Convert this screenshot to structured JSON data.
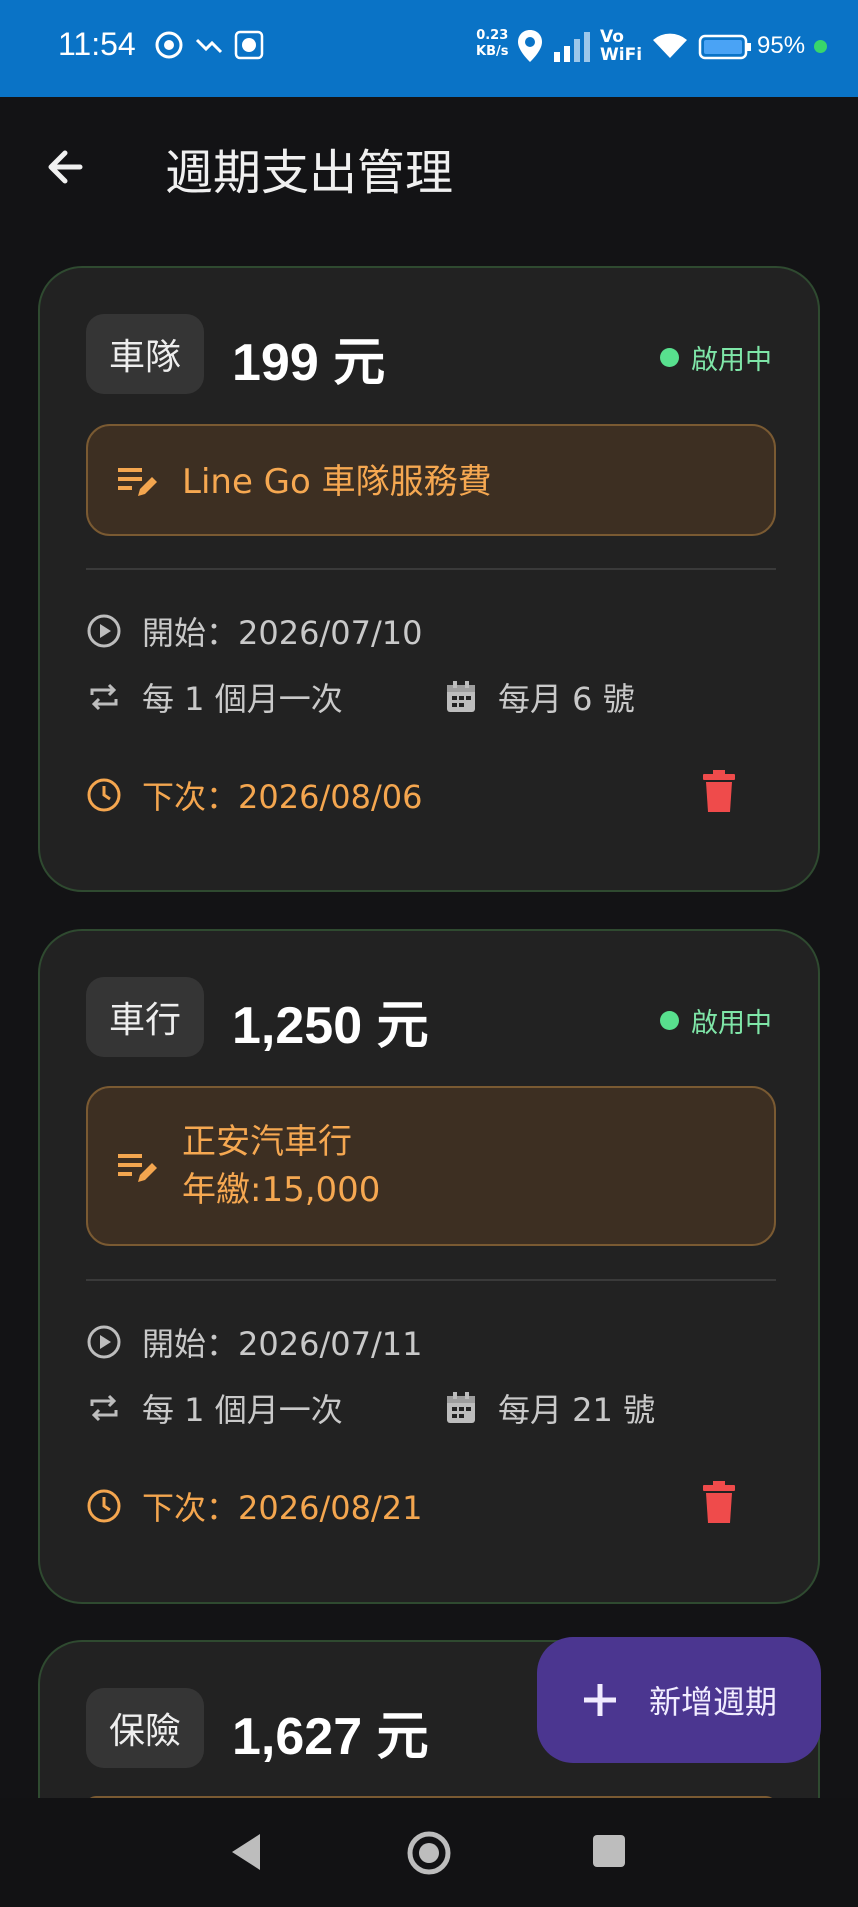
{
  "status_bar": {
    "time": "11:54",
    "net_speed_value": "0.23",
    "net_speed_unit": "KB/s",
    "vowifi_top": "Vo",
    "vowifi_bottom": "WiFi",
    "battery": "95%"
  },
  "header": {
    "title": "週期支出管理"
  },
  "cards": [
    {
      "category": "車隊",
      "amount": "199 元",
      "status": "啟用中",
      "note_line1": "Line Go 車隊服務費",
      "note_line2": "",
      "start": "開始：2026/07/10",
      "frequency": "每 1 個月一次",
      "day": "每月 6 號",
      "next": "下次：2026/08/06"
    },
    {
      "category": "車行",
      "amount": "1,250 元",
      "status": "啟用中",
      "note_line1": "正安汽車行",
      "note_line2": "年繳:15,000",
      "start": "開始：2026/07/11",
      "frequency": "每 1 個月一次",
      "day": "每月 21 號",
      "next": "下次：2026/08/21"
    },
    {
      "category": "保險",
      "amount": "1,627 元"
    }
  ],
  "fab": {
    "label": "新增週期"
  },
  "colors": {
    "status_bar": "#0a73c6",
    "background": "#131315",
    "card": "#222222",
    "accent_orange": "#f4a64f",
    "active_green": "#58e08e",
    "delete_red": "#ef4b4b",
    "fab": "#4b3690"
  }
}
